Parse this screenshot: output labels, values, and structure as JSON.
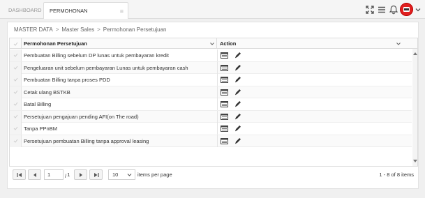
{
  "tabs": {
    "dashboard": "DASHBOARD",
    "active": "PERMOHONAN PERSETUJUAN",
    "active_menu": "≡"
  },
  "header_icons": [
    "expand-icon",
    "menu-icon",
    "bell-icon",
    "avatar",
    "chevron-down-icon"
  ],
  "colors": {
    "avatar": "#e02020",
    "accent": "#333333"
  },
  "breadcrumb": {
    "item1": "MASTER DATA",
    "item2": "Master Sales",
    "item3": "Permohonan Persetujuan",
    "separator": ">"
  },
  "grid": {
    "columns": {
      "name": "Permohonan Persetujuan",
      "action": "Action"
    },
    "rows": [
      {
        "label": "Pembuatan Billing sebelum DP lunas untuk pembayaran kredit"
      },
      {
        "label": "Pengeluaran unit sebelum pembayaran Lunas untuk pembayaran cash"
      },
      {
        "label": "Pembuatan Billing tanpa proses PDD"
      },
      {
        "label": "Cetak ulang BSTKB"
      },
      {
        "label": "Batal Billing"
      },
      {
        "label": "Persetujuan pengajuan pending AFI(on The road)"
      },
      {
        "label": "Tanpa PPnBM"
      },
      {
        "label": "Persetujuan pembuatan Billing tanpa approval leasing"
      }
    ],
    "action_icons": [
      "detail-icon",
      "edit-icon"
    ]
  },
  "pager": {
    "page_value": "1",
    "page_total": "1",
    "page_total_prefix": "/",
    "page_size": "10",
    "per_page_label": "items per page",
    "items_info": "1 - 8 of 8 items"
  }
}
